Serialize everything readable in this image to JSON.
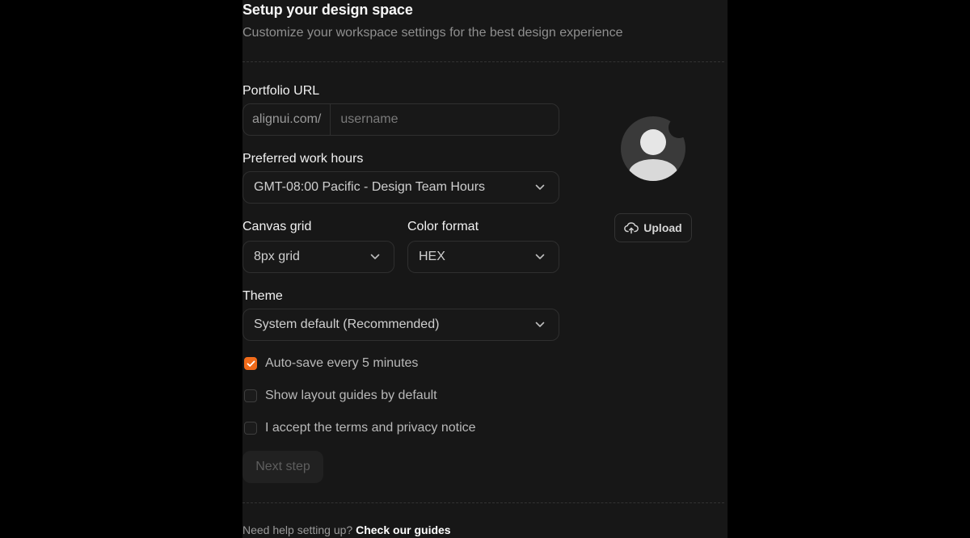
{
  "header": {
    "title": "Setup your design space",
    "subtitle": "Customize your workspace settings for the best design experience"
  },
  "portfolio": {
    "label": "Portfolio URL",
    "prefix": "alignui.com/",
    "placeholder": "username",
    "value": ""
  },
  "work_hours": {
    "label": "Preferred work hours",
    "selected": "GMT-08:00 Pacific - Design Team Hours"
  },
  "canvas_grid": {
    "label": "Canvas grid",
    "selected": "8px grid"
  },
  "color_format": {
    "label": "Color format",
    "selected": "HEX"
  },
  "theme": {
    "label": "Theme",
    "selected": "System default (Recommended)"
  },
  "checkboxes": [
    {
      "label": "Auto-save every 5 minutes",
      "checked": true
    },
    {
      "label": "Show layout guides by default",
      "checked": false
    },
    {
      "label": "I accept the terms and privacy notice",
      "checked": false
    }
  ],
  "actions": {
    "next_label": "Next step",
    "upload_label": "Upload"
  },
  "footer": {
    "help_text": "Need help setting up?",
    "help_link": "Check our guides"
  },
  "colors": {
    "accent": "#f16b1a",
    "background": "#000000",
    "panel": "#171717"
  },
  "icons": {
    "chevron": "chevron-down-icon",
    "check": "check-icon",
    "upload": "cloud-upload-icon",
    "avatar": "user-avatar-icon"
  }
}
